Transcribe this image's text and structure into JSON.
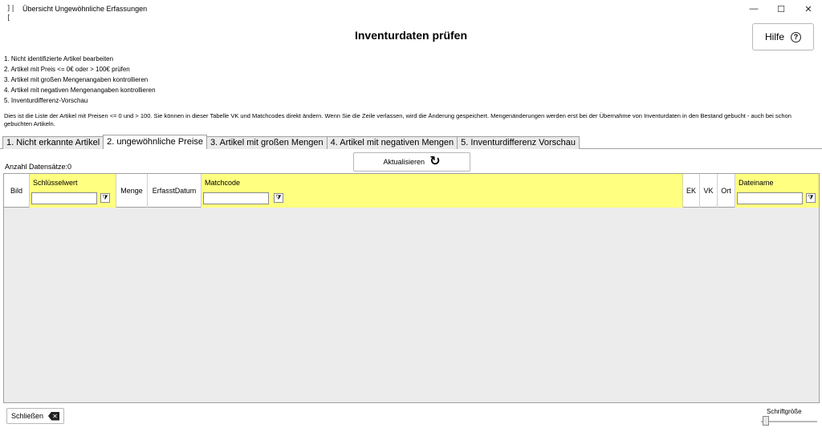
{
  "window": {
    "app_icon": "]|[",
    "title": "Übersicht Ungewöhnliche Erfassungen",
    "controls": {
      "minimize": "—",
      "maximize": "☐",
      "close": "✕"
    }
  },
  "header": {
    "title": "Inventurdaten prüfen",
    "help_label": "Hilfe",
    "help_icon": "?"
  },
  "steps": [
    "1. Nicht identifizierte Artikel bearbeiten",
    "2. Artikel mit Preis <= 0€ oder > 100€ prüfen",
    "3. Artikel mit großen Mengenangaben kontrollieren",
    "4. Artikel mit negativen Mengenangaben kontrollieren",
    "5. Inventurdifferenz-Vorschau"
  ],
  "description": "Dies ist die Liste der Artikel mit Preisen <= 0 und > 100. Sie können in dieser Tabelle VK und Matchcodes direkt ändern. Wenn Sie die Zeile verlassen, wird die Änderung gespeichert. Mengenänderungen werden erst bei der Übernahme von Inventurdaten in den Bestand gebucht - auch bei schon gebuchten Artikeln.",
  "tabs": [
    {
      "label": "1. Nicht erkannte Artikel"
    },
    {
      "label": "2. ungewöhnliche Preise"
    },
    {
      "label": "3. Artikel mit großen Mengen"
    },
    {
      "label": "4. Artikel mit negativen Mengen"
    },
    {
      "label": "5. Inventurdifferenz Vorschau"
    }
  ],
  "active_tab": 1,
  "toolbar": {
    "count_label": "Anzahl Datensätze:0",
    "refresh_label": "Aktualisieren",
    "refresh_icon": "↻"
  },
  "grid": {
    "columns": {
      "bild": "Bild",
      "schluesselwert": "Schlüsselwert",
      "menge": "Menge",
      "erfasst": "ErfasstDatum",
      "matchcode": "Matchcode",
      "ek": "EK",
      "vk": "VK",
      "ort": "Ort",
      "dateiname": "Dateiname"
    },
    "filter_icon": "⧩",
    "highlight_color": "#ffff80"
  },
  "footer": {
    "close_label": "Schließen",
    "close_icon": "✕",
    "font_size_label": "Schriftgröße"
  }
}
